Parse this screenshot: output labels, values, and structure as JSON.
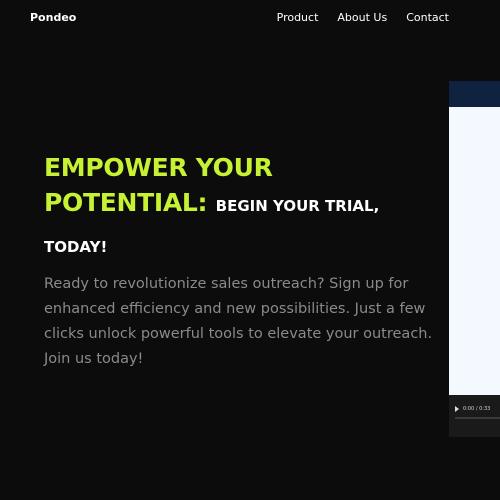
{
  "header": {
    "brand": "Pondeo",
    "nav": [
      {
        "label": "Product"
      },
      {
        "label": "About Us"
      },
      {
        "label": "Contact"
      }
    ]
  },
  "hero": {
    "headline_line1": "EMPOWER YOUR",
    "headline_line2_accent": "POTENTIAL:",
    "headline_line2_rest": "BEGIN YOUR TRIAL,",
    "headline_line3": "TODAY!",
    "description": "Ready to revolutionize sales outreach? Sign up for enhanced efficiency and new possibilities. Just a few clicks unlock powerful tools to elevate your outreach. Join us today!"
  },
  "video": {
    "time": "0:00 / 0:33",
    "progress": 0
  },
  "colors": {
    "background": "#0c0c0c",
    "accent": "#c6f233",
    "text_muted": "#8a8a8a"
  }
}
